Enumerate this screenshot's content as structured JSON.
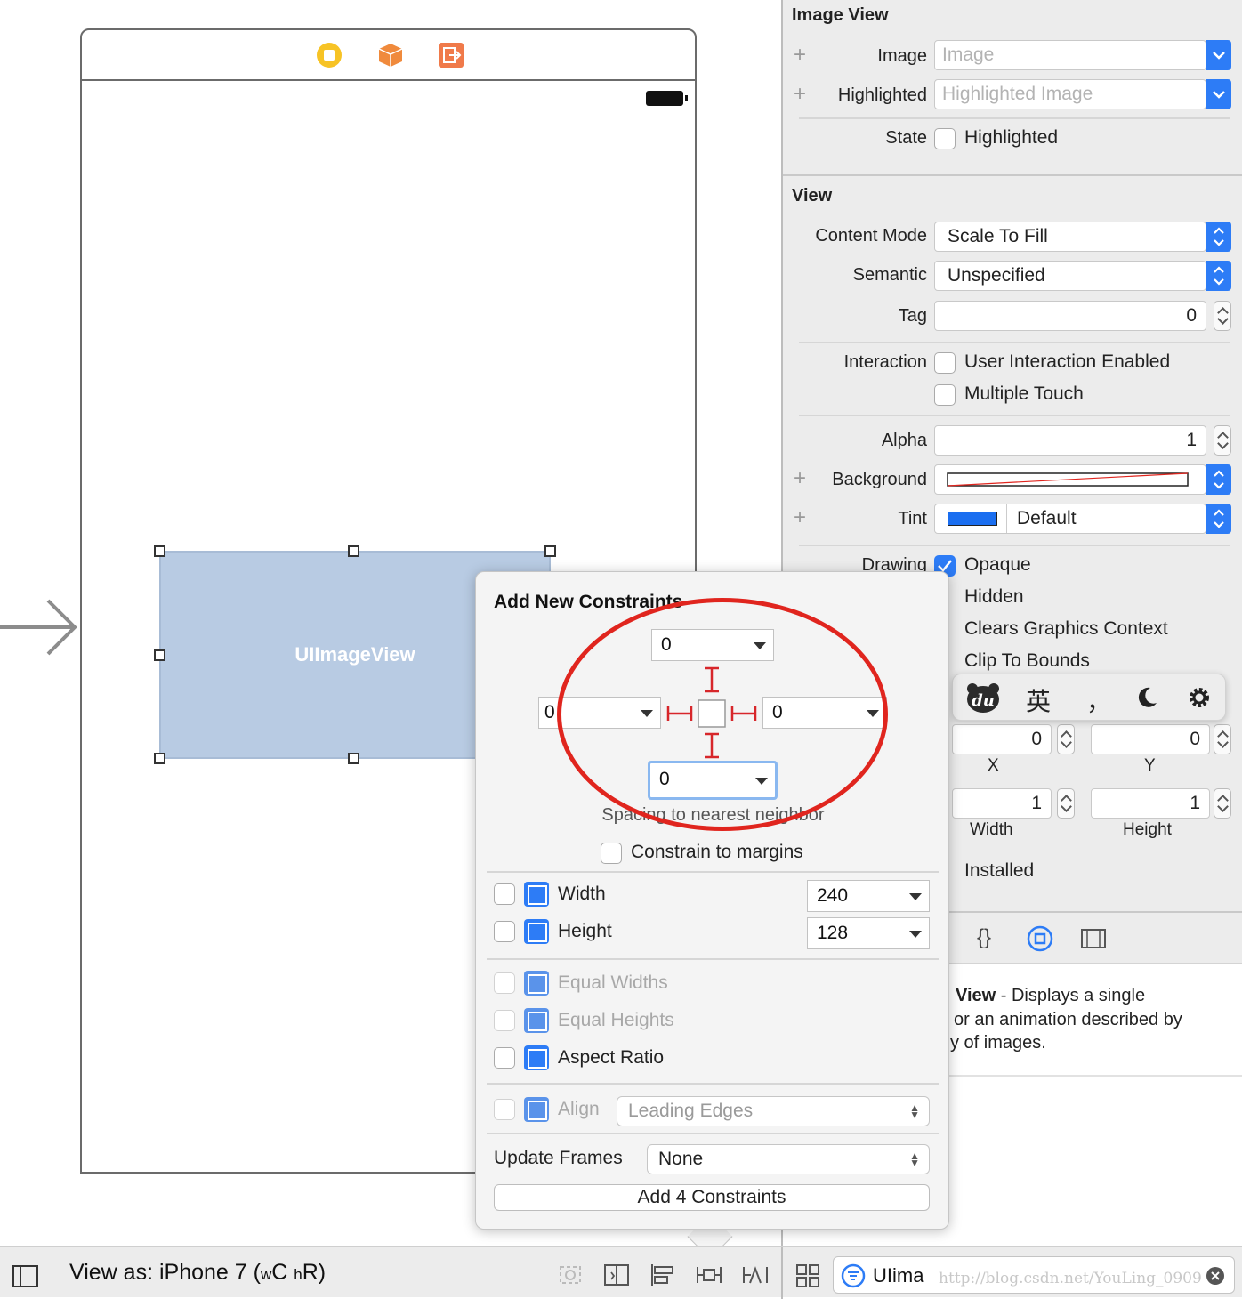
{
  "scene": {
    "image_view_label": "UIImageView"
  },
  "inspector": {
    "image_view": {
      "title": "Image View",
      "image_label": "Image",
      "image_placeholder": "Image",
      "highlighted_label": "Highlighted",
      "highlighted_placeholder": "Highlighted Image",
      "state_label": "State",
      "state_checkbox": "Highlighted"
    },
    "view": {
      "title": "View",
      "content_mode_label": "Content Mode",
      "content_mode_value": "Scale To Fill",
      "semantic_label": "Semantic",
      "semantic_value": "Unspecified",
      "tag_label": "Tag",
      "tag_value": "0",
      "interaction_label": "Interaction",
      "user_interaction": "User Interaction Enabled",
      "multiple_touch": "Multiple Touch",
      "alpha_label": "Alpha",
      "alpha_value": "1",
      "background_label": "Background",
      "tint_label": "Tint",
      "tint_value": "Default",
      "tint_color": "#1a6ef0",
      "drawing_label": "Drawing",
      "opaque": "Opaque",
      "hidden": "Hidden",
      "clears_graphics": "Clears Graphics Context",
      "clip_to_bounds": "Clip To Bounds"
    },
    "stretching": {
      "x_value": "0",
      "y_value": "0",
      "x_label": "X",
      "y_label": "Y",
      "width_value": "1",
      "height_value": "1",
      "width_label": "Width",
      "height_label": "Height"
    },
    "installed": "Installed",
    "library": {
      "title_bold": "View",
      "line1": " - Displays a single",
      "line2": "or an animation described by",
      "line3": "y of images."
    }
  },
  "popover": {
    "title": "Add New Constraints",
    "top_value": "0",
    "left_value": "0",
    "right_value": "0",
    "bottom_value": "0",
    "spacing_caption": "Spacing to nearest neighbor",
    "constrain_margins": "Constrain to margins",
    "width_label": "Width",
    "width_value": "240",
    "height_label": "Height",
    "height_value": "128",
    "equal_widths": "Equal Widths",
    "equal_heights": "Equal Heights",
    "aspect_ratio": "Aspect Ratio",
    "align_label": "Align",
    "align_value": "Leading Edges",
    "update_frames_label": "Update Frames",
    "update_frames_value": "None",
    "add_button": "Add 4 Constraints"
  },
  "ime_bar": {
    "lang": "英",
    "punct": "，"
  },
  "bottombar": {
    "view_as": "View as: iPhone 7 (",
    "size_w": "w",
    "size_c": "C",
    "size_h": "h",
    "size_r": "R)",
    "filter_text": "UIima",
    "watermark": "http://blog.csdn.net/YouLing_0909"
  },
  "colors": {
    "accent": "#2d7cf6",
    "constraint_red": "#d7262a",
    "annotation_red": "#e0251e",
    "selection_fill": "#b8cbe3"
  }
}
